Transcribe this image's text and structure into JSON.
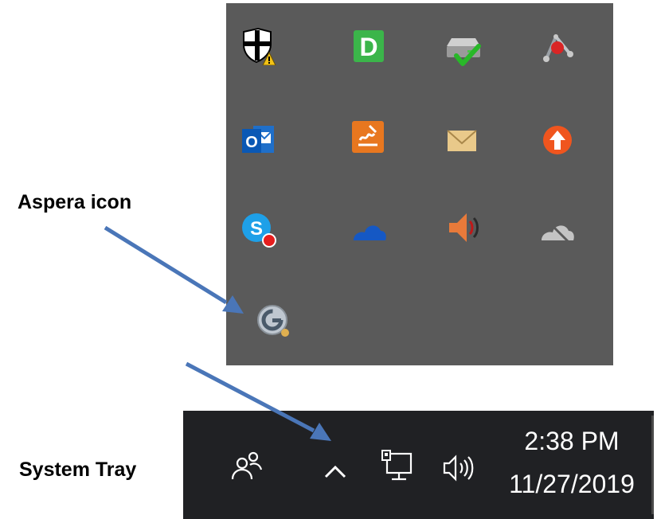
{
  "annotations": {
    "aspera_label": "Aspera icon",
    "tray_label": "System Tray"
  },
  "overflow_panel": {
    "background": "#5a5a5a",
    "icons": [
      {
        "name": "windows-security-warning-icon"
      },
      {
        "name": "dashlane-icon",
        "letter": "D"
      },
      {
        "name": "backup-drive-check-icon"
      },
      {
        "name": "network-tool-icon"
      },
      {
        "name": "outlook-icon",
        "letter": "O"
      },
      {
        "name": "signing-pad-icon"
      },
      {
        "name": "mail-envelope-icon"
      },
      {
        "name": "update-arrow-icon"
      },
      {
        "name": "skype-icon",
        "letter": "S"
      },
      {
        "name": "onedrive-icon"
      },
      {
        "name": "volume-speaker-icon"
      },
      {
        "name": "onedrive-offline-icon"
      },
      {
        "name": "aspera-icon"
      }
    ]
  },
  "taskbar": {
    "background": "#202124",
    "time": "2:38 PM",
    "date": "11/27/2019",
    "icons": [
      "people-icon",
      "chevron-up-icon",
      "network-icon",
      "volume-icon"
    ]
  },
  "colors": {
    "arrow": "#4a76b8"
  }
}
